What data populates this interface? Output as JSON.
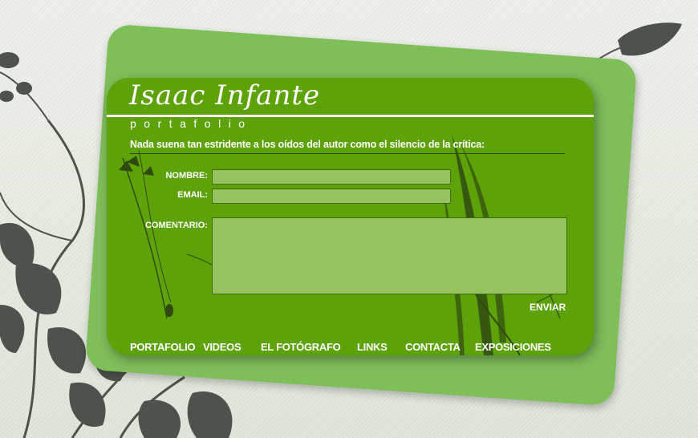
{
  "brand": {
    "name": "Isaac Infante",
    "subtitle": "portafolio",
    "tagline": "Nada suena tan estridente a los oídos del autor como el silencio de la crítica:"
  },
  "form": {
    "name_label": "NOMBRE:",
    "name_value": "",
    "email_label": "EMAIL:",
    "email_value": "",
    "comment_label": "COMENTARIO:",
    "comment_value": "",
    "submit_label": "ENVIAR"
  },
  "nav": {
    "items": [
      {
        "label": "PORTAFOLIO"
      },
      {
        "label": "VIDEOS"
      },
      {
        "label": "EL FOTÓGRAFO"
      },
      {
        "label": "LINKS"
      },
      {
        "label": "CONTACTA"
      },
      {
        "label": "EXPOSICIONES"
      }
    ]
  },
  "colors": {
    "card_green": "#5ea20a",
    "back_card_green": "#7fbf5a",
    "field_fill": "#96c25f",
    "silhouette": "#4a4f47",
    "background": "#e6eae1"
  }
}
